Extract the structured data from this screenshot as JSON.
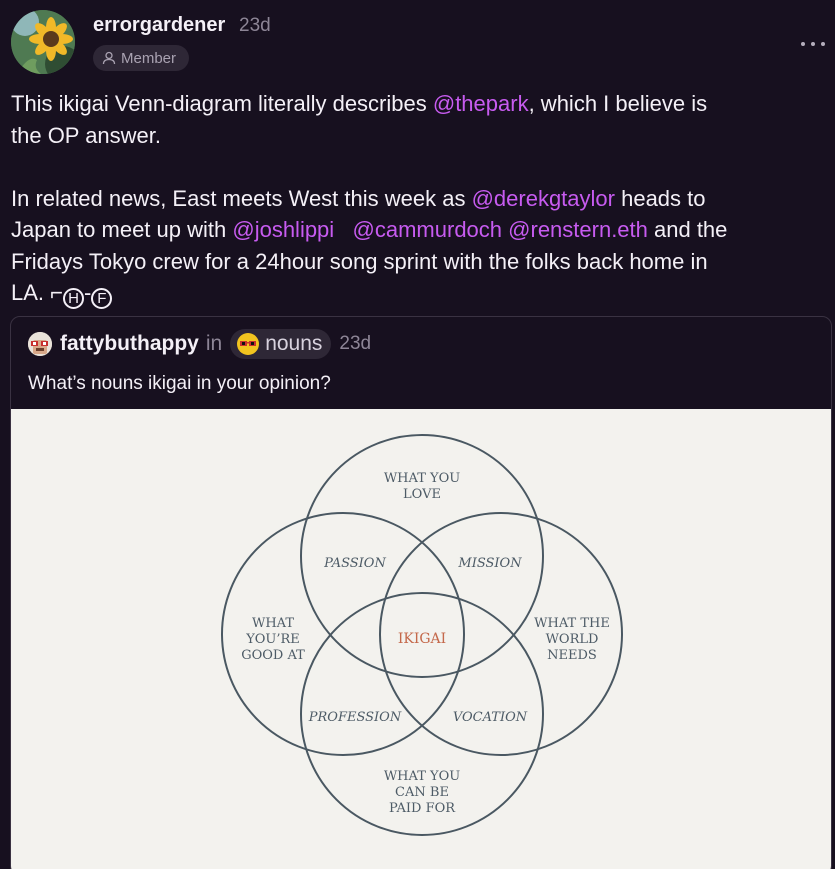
{
  "post": {
    "username": "errorgardener",
    "timestamp": "23d",
    "badge": "Member",
    "avatar_icon": "sunflower-avatar",
    "line1_a": "This ikigai Venn-diagram literally describes ",
    "mention_thepark": "@thepark",
    "line1_b": ", which I believe is",
    "line2": "the OP answer.",
    "line3_a": "In related news, East meets West this week as ",
    "mention_derek": "@derekgtaylor",
    "line3_b": " heads to",
    "line4_a": "Japan to meet up with ",
    "mention_josh": "@joshlippi",
    "line4_sp": "   ",
    "mention_cam": "@cammurdoch",
    "line4_sp2": " ",
    "mention_ren": "@renstern.eth",
    "line4_b": " and the",
    "line5": "Fridays Tokyo crew for a 24hour song sprint with the folks back home in",
    "line6_a": "LA. ⌐",
    "circle_h": "H",
    "dash": "-",
    "circle_f": "F"
  },
  "quote": {
    "username": "fattybuthappy",
    "in": "in",
    "channel": "nouns",
    "timestamp": "23d",
    "text": "What’s nouns ikigai in your opinion?"
  },
  "venn": {
    "love_1": "WHAT YOU",
    "love_2": "LOVE",
    "good_1": "WHAT",
    "good_2": "YOU’RE",
    "good_3": "GOOD AT",
    "needs_1": "WHAT THE",
    "needs_2": "WORLD",
    "needs_3": "NEEDS",
    "paid_1": "WHAT YOU",
    "paid_2": "CAN BE",
    "paid_3": "PAID FOR",
    "passion": "PASSION",
    "mission": "MISSION",
    "profession": "PROFESSION",
    "vocation": "VOCATION",
    "ikigai": "IKIGAI"
  },
  "colors": {
    "background": "#17101f",
    "mention": "#c75bf0",
    "circle_stroke": "#4a5862",
    "ikigai": "#c4684a"
  }
}
